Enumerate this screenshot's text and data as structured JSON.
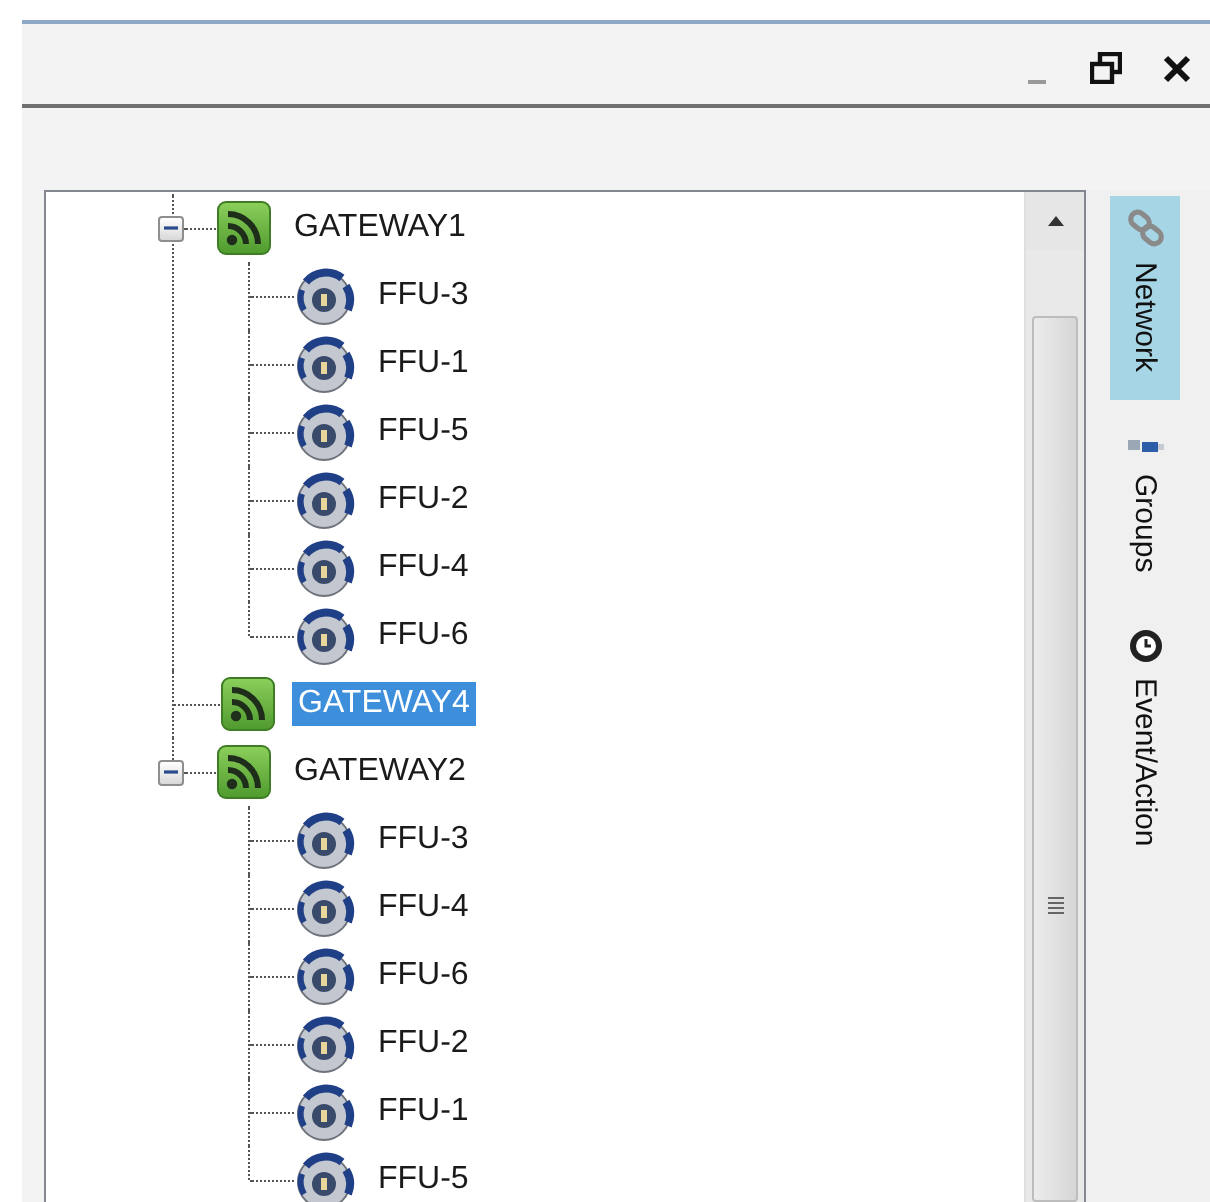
{
  "tree": {
    "items": [
      {
        "label": "GATEWAY1",
        "kind": "gateway",
        "expanded": true,
        "selected": false,
        "children": [
          {
            "label": "FFU-3",
            "kind": "ffu",
            "selected": false
          },
          {
            "label": "FFU-1",
            "kind": "ffu",
            "selected": false
          },
          {
            "label": "FFU-5",
            "kind": "ffu",
            "selected": false
          },
          {
            "label": "FFU-2",
            "kind": "ffu",
            "selected": false
          },
          {
            "label": "FFU-4",
            "kind": "ffu",
            "selected": false
          },
          {
            "label": "FFU-6",
            "kind": "ffu",
            "selected": false
          }
        ]
      },
      {
        "label": "GATEWAY4",
        "kind": "gateway",
        "selected": true
      },
      {
        "label": "GATEWAY2",
        "kind": "gateway",
        "expanded": true,
        "selected": false,
        "children": [
          {
            "label": "FFU-3",
            "kind": "ffu",
            "selected": false
          },
          {
            "label": "FFU-4",
            "kind": "ffu",
            "selected": false
          },
          {
            "label": "FFU-6",
            "kind": "ffu",
            "selected": false
          },
          {
            "label": "FFU-2",
            "kind": "ffu",
            "selected": false
          },
          {
            "label": "FFU-1",
            "kind": "ffu",
            "selected": false
          },
          {
            "label": "FFU-5",
            "kind": "ffu",
            "selected": false
          }
        ]
      }
    ]
  },
  "side_tabs": [
    {
      "label": "Network",
      "kind": "network",
      "selected": true
    },
    {
      "label": "Groups",
      "kind": "groups",
      "selected": false
    },
    {
      "label": "Event/Action",
      "kind": "event",
      "selected": false
    }
  ]
}
